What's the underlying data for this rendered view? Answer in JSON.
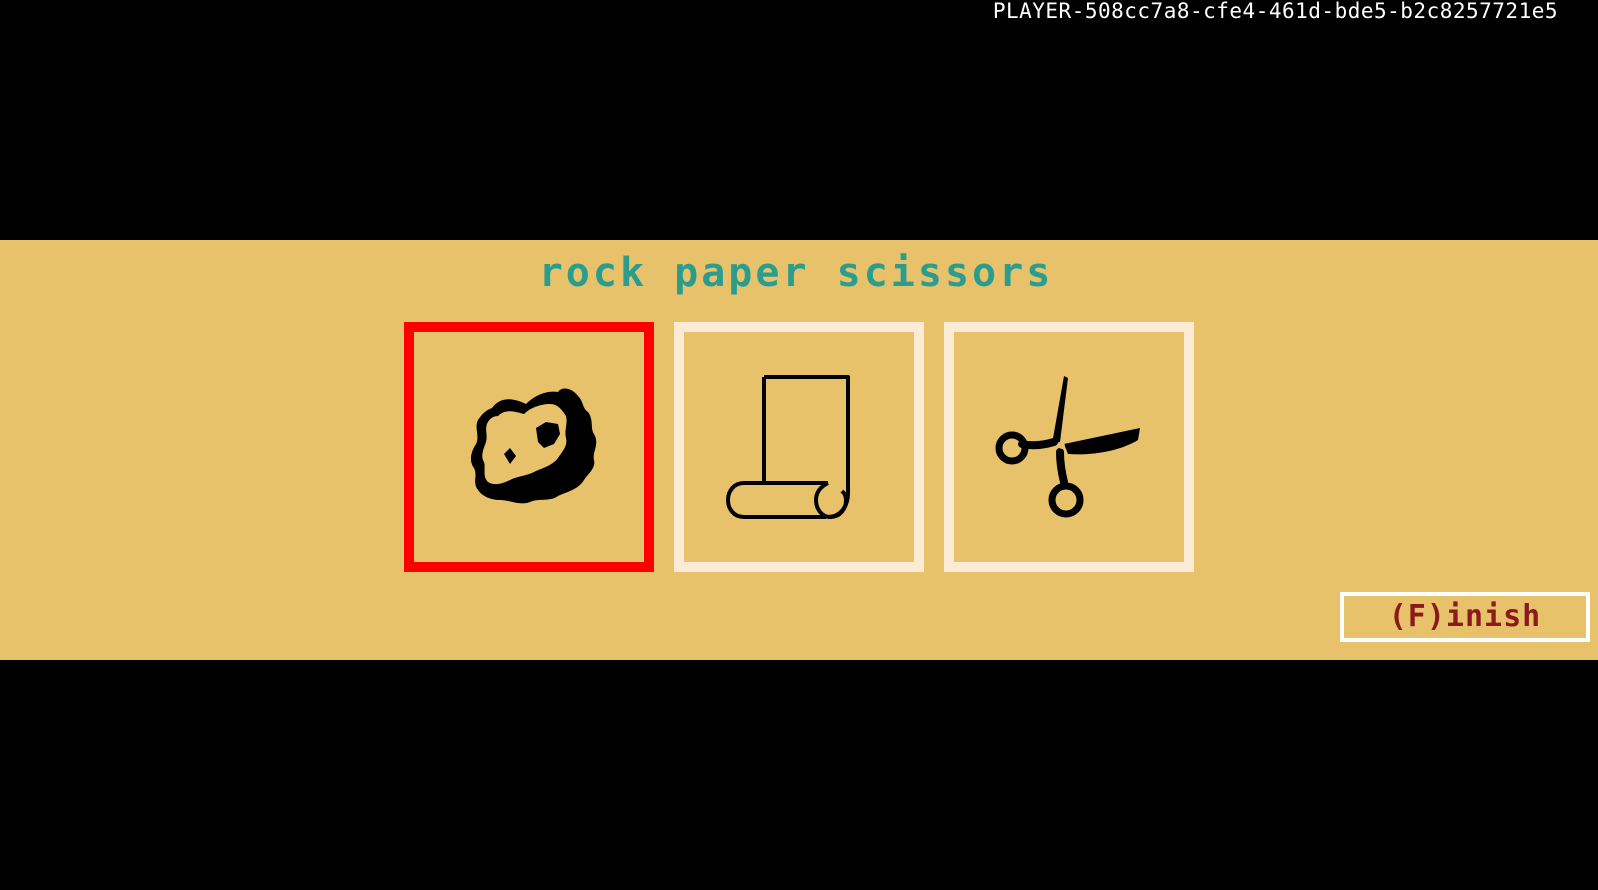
{
  "player": {
    "id": "PLAYER-508cc7a8-cfe4-461d-bde5-b2c8257721e5"
  },
  "game": {
    "title": "rock paper scissors",
    "choices": [
      {
        "label": "rock",
        "icon": "rock-icon",
        "selected": true
      },
      {
        "label": "paper",
        "icon": "paper-scroll-icon",
        "selected": false
      },
      {
        "label": "scissors",
        "icon": "scissors-icon",
        "selected": false
      }
    ],
    "finish_label": "(F)inish"
  },
  "colors": {
    "background": "#000000",
    "band": "#e8c26b",
    "title": "#2a9d8f",
    "card_border": "#fbebd4",
    "selected_border": "#ff0000",
    "finish_text": "#8b1a1a",
    "player_id_text": "#ffffff"
  }
}
